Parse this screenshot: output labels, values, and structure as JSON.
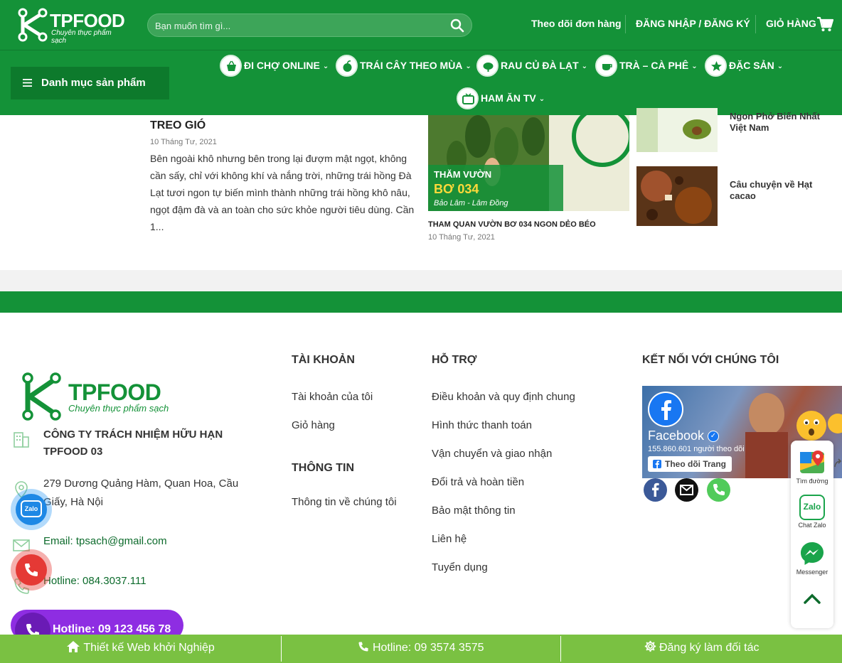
{
  "header": {
    "logo_text": "TPFOOD",
    "logo_tagline": "Chuyên thực phẩm sạch",
    "search_placeholder": "Bạn muốn tìm gì...",
    "track_order": "Theo dõi đơn hàng",
    "login_register": "ĐĂNG NHẬP / ĐĂNG KÝ",
    "cart": "GIỎ HÀNG"
  },
  "nav": {
    "category_button": "Danh mục sản phẩm",
    "items": [
      {
        "label": "ĐI CHỢ ONLINE",
        "icon": "basket-icon"
      },
      {
        "label": "TRÁI CÂY THEO MÙA",
        "icon": "fruit-icon"
      },
      {
        "label": "RAU CỦ ĐÀ LẠT",
        "icon": "vegetable-icon"
      },
      {
        "label": "TRÀ – CÀ PHÊ",
        "icon": "tea-cup-icon"
      },
      {
        "label": "ĐẶC SẢN",
        "icon": "specialty-icon"
      },
      {
        "label": "HAM ĂN TV",
        "icon": "tv-icon"
      }
    ]
  },
  "posts": {
    "main": {
      "title": "TREO GIÓ",
      "date": "10 Tháng Tư, 2021",
      "excerpt": "Bên ngoài khô nhưng bên trong lại đượm mật ngọt, không cần sấy, chỉ với không khí và nắng trời, những trái hồng Đà Lạt tươi ngon tự biến mình thành những trái hồng khô nâu, ngọt đậm đà và an toàn cho sức khỏe người tiêu dùng. Cần 1..."
    },
    "feature": {
      "image_line1": "THĂM VƯỜN",
      "image_line2": "BƠ 034",
      "image_line3": "Bảo Lâm - Lâm Đồng",
      "title": "THAM QUAN VƯỜN BƠ 034 NGON DẺO BÉO",
      "date": "10 Tháng Tư, 2021"
    },
    "side": [
      {
        "title": "Ngon Phở Biến Nhất Việt Nam"
      },
      {
        "title": "Câu chuyện về Hạt cacao"
      }
    ]
  },
  "footer": {
    "logo_text": "TPFOOD",
    "logo_tagline": "Chuyên thực phẩm sạch",
    "company": "CÔNG TY TRÁCH NHIỆM HỮU HẠN TPFOOD 03",
    "address": "279 Dương Quảng Hàm, Quan Hoa, Cầu Giấy, Hà Nội",
    "email": "Email: tpsach@gmail.com",
    "hotline": "Hotline: 084.3037.111",
    "account_heading": "TÀI KHOẢN",
    "account_links": [
      "Tài khoản của tôi",
      "Giỏ hàng"
    ],
    "info_heading": "THÔNG TIN",
    "info_links": [
      "Thông tin về chúng tôi"
    ],
    "support_heading": "HỖ TRỢ",
    "support_links": [
      "Điều khoản và quy định chung",
      "Hình thức thanh toán",
      "Vận chuyển và giao nhận",
      "Đổi trả và hoàn tiền",
      "Bảo mật thông tin",
      "Liên hệ",
      "Tuyển dụng"
    ],
    "connect_heading": "KẾT NỐI VỚI CHÚNG TÔI",
    "facebook": {
      "name": "Facebook",
      "followers": "155.860.601 người theo dõi",
      "follow_button": "Theo dõi Trang"
    }
  },
  "floating": {
    "directions": "Tìm đường",
    "chat_zalo": "Chat Zalo",
    "zalo_logo": "Zalo",
    "zalo_bubble": "Zalo",
    "messenger": "Messenger",
    "hotline_pill": "Hotline: 09 123 456 78"
  },
  "bottom_bar": {
    "web_design": "Thiết kế Web khởi Nghiệp",
    "hotline": "Hotline: 09 3574 3575",
    "partner": "Đăng ký làm đối tác"
  },
  "colors": {
    "brand_green": "#149238",
    "bottom_bar_green": "#7ac142",
    "zalo_blue": "#1e88e5",
    "phone_red": "#e53935",
    "hotline_purple": "#8e2de2"
  }
}
